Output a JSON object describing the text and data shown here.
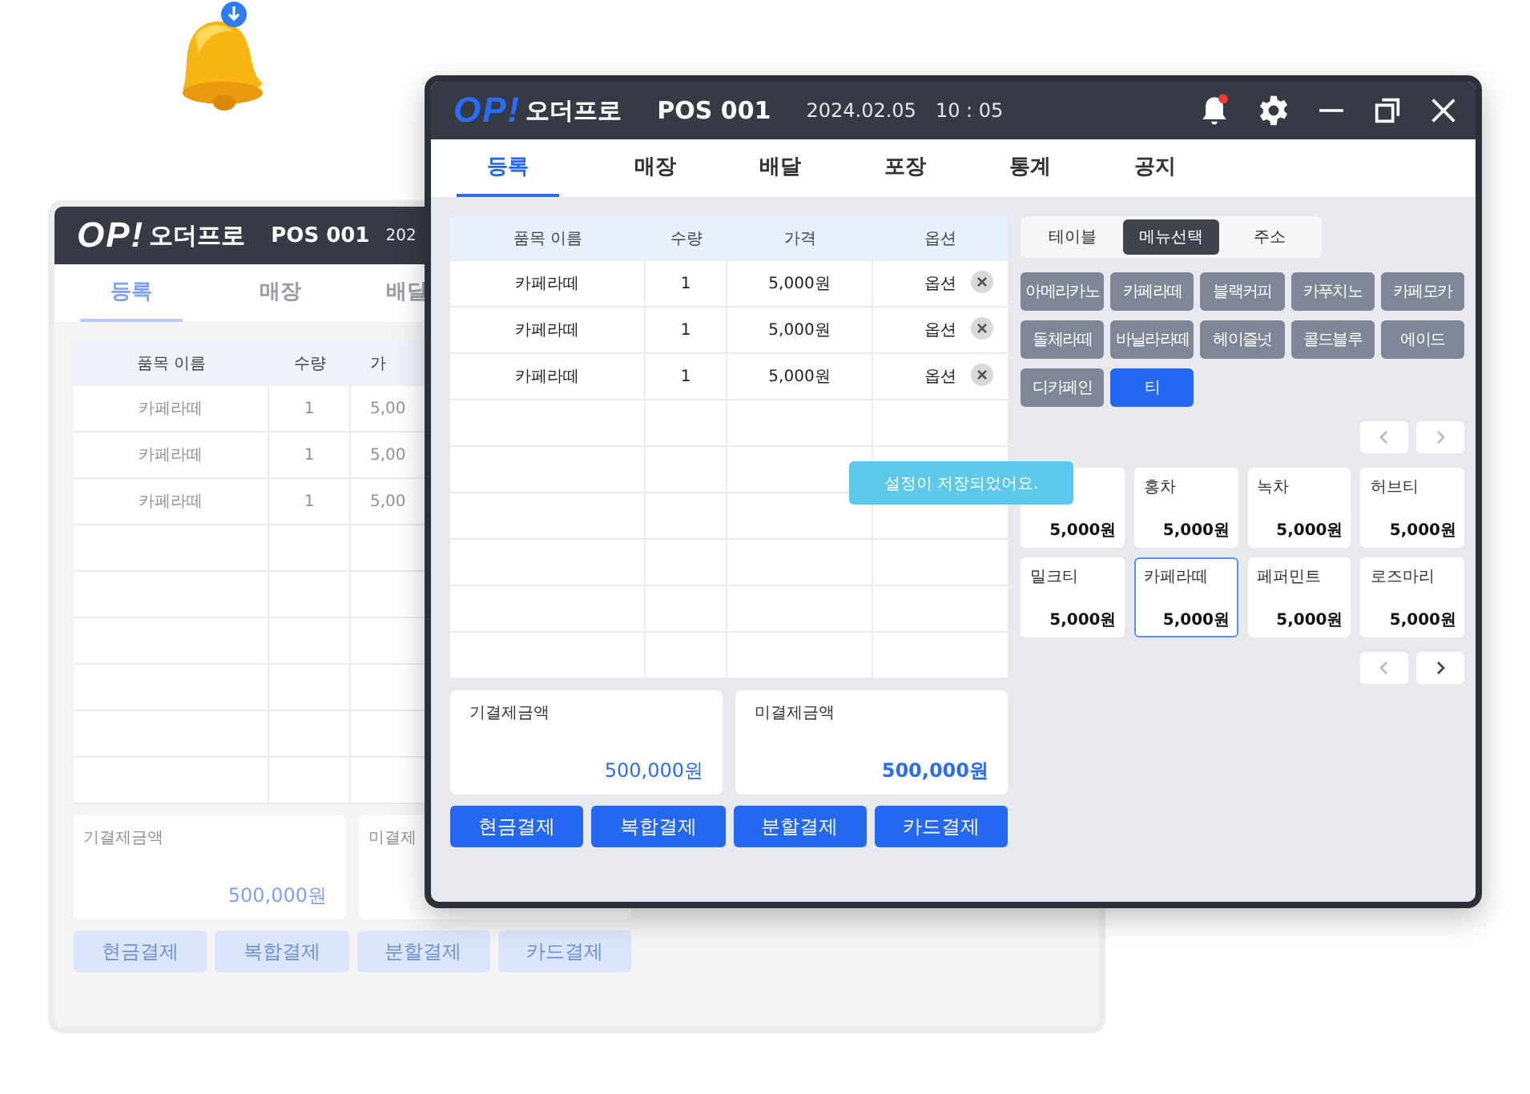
{
  "back_window": {
    "logo_mark": "OP!",
    "logo_text": "오더프로",
    "pos": "POS 001",
    "date": "202",
    "tabs": [
      {
        "label": "등록",
        "selected": true
      },
      {
        "label": "매장",
        "selected": false
      },
      {
        "label": "배달",
        "selected": false
      }
    ],
    "table": {
      "columns": [
        "품목 이름",
        "수량",
        "가"
      ],
      "rows": [
        [
          "카페라떼",
          "1",
          "5,00"
        ],
        [
          "카페라떼",
          "1",
          "5,00"
        ],
        [
          "카페라떼",
          "1",
          "5,00"
        ]
      ]
    },
    "summary": [
      {
        "label": "기결제금액",
        "amount": "500,000원"
      },
      {
        "label": "미결제"
      }
    ],
    "buttons": [
      "현금결제",
      "복합결제",
      "분할결제",
      "카드결제"
    ]
  },
  "window": {
    "logo_mark": "OP!",
    "logo_text": "오더프로",
    "pos": "POS 001",
    "date": "2024.02.05",
    "time": "10 : 05",
    "notification": true,
    "tabs": [
      {
        "label": "등록",
        "selected": true
      },
      {
        "label": "매장",
        "selected": false
      },
      {
        "label": "배달",
        "selected": false
      },
      {
        "label": "포장",
        "selected": false
      },
      {
        "label": "통계",
        "selected": false
      },
      {
        "label": "공지",
        "selected": false
      }
    ],
    "table": {
      "columns": [
        "품목 이름",
        "수량",
        "가격",
        "옵션"
      ],
      "rows": [
        {
          "name": "카페라떼",
          "qty": "1",
          "price": "5,000원",
          "option": "옵션"
        },
        {
          "name": "카페라떼",
          "qty": "1",
          "price": "5,000원",
          "option": "옵션"
        },
        {
          "name": "카페라떼",
          "qty": "1",
          "price": "5,000원",
          "option": "옵션"
        }
      ]
    },
    "summary": [
      {
        "label": "기결제금액",
        "amount": "500,000원",
        "emphasized": false
      },
      {
        "label": "미결제금액",
        "amount": "500,000원",
        "emphasized": true
      }
    ],
    "payment_buttons": [
      "현금결제",
      "복합결제",
      "분할결제",
      "카드결제"
    ],
    "segments": [
      {
        "label": "테이블",
        "selected": false
      },
      {
        "label": "메뉴선택",
        "selected": true
      },
      {
        "label": "주소",
        "selected": false
      }
    ],
    "categories": [
      {
        "label": "아메리카노",
        "selected": false
      },
      {
        "label": "카페라떼",
        "selected": false
      },
      {
        "label": "블랙커피",
        "selected": false
      },
      {
        "label": "카푸치노",
        "selected": false
      },
      {
        "label": "카페모카",
        "selected": false
      },
      {
        "label": "돌체라떼",
        "selected": false
      },
      {
        "label": "바닐라라떼",
        "selected": false
      },
      {
        "label": "헤이즐넛",
        "selected": false
      },
      {
        "label": "콜드블루",
        "selected": false
      },
      {
        "label": "에이드",
        "selected": false
      },
      {
        "label": "디카페인",
        "selected": false
      },
      {
        "label": "티",
        "selected": true
      }
    ],
    "category_pager": {
      "prev_disabled": true,
      "next_disabled": true
    },
    "products": [
      {
        "price": "5,000원",
        "selected": false
      },
      {
        "name": "홍차",
        "price": "5,000원",
        "selected": false
      },
      {
        "name": "녹차",
        "price": "5,000원",
        "selected": false
      },
      {
        "name": "허브티",
        "price": "5,000원",
        "selected": false
      },
      {
        "name": "밀크티",
        "price": "5,000원",
        "selected": false
      },
      {
        "name": "카페라떼",
        "price": "5,000원",
        "selected": true
      },
      {
        "name": "페퍼민트",
        "price": "5,000원",
        "selected": false
      },
      {
        "name": "로즈마리",
        "price": "5,000원",
        "selected": false
      }
    ],
    "product_pager": {
      "prev_disabled": true,
      "next_disabled": false
    },
    "toast": "설정이 저장되었어요."
  }
}
